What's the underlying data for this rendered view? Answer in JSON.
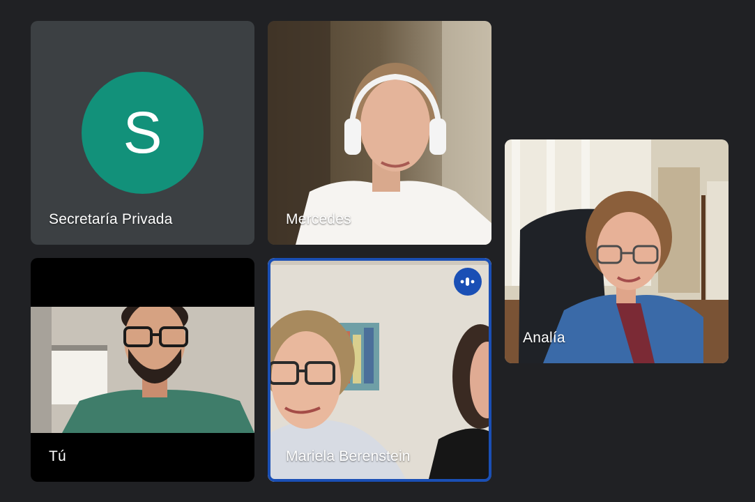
{
  "meeting": {
    "participants": [
      {
        "name": "Secretaría Privada",
        "avatar_letter": "S",
        "avatar_color": "#12917a"
      },
      {
        "name": "Mercedes"
      },
      {
        "name": "Analía"
      },
      {
        "name": "Tú"
      },
      {
        "name": "Mariela Berenstein",
        "speaking": true
      }
    ],
    "colors": {
      "background": "#202124",
      "tile_bg": "#3c4043",
      "active_speaker": "#1a4fb5"
    },
    "icons": {
      "speaking": "audio-level-icon"
    }
  }
}
